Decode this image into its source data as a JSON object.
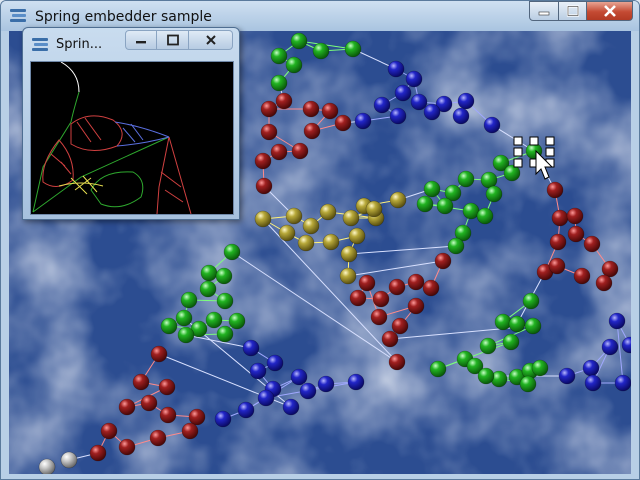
{
  "main_window": {
    "title": "Spring embedder sample",
    "icons": {
      "app": "app-icon",
      "minimize": "minimize-icon",
      "maximize": "maximize-icon",
      "close": "close-icon"
    }
  },
  "sub_window": {
    "title": "Sprin...",
    "icons": {
      "app": "app-icon",
      "minimize": "minimize-icon",
      "maximize": "maximize-icon",
      "close": "close-icon"
    }
  },
  "colors": {
    "background_blue": "#2c4d91",
    "node_red": "#8b1a1a",
    "node_green": "#22b422",
    "node_blue": "#2226c8",
    "node_yellow": "#b8a93a",
    "node_gray": "#c8c8c8",
    "close_red": "#c44a33"
  },
  "graph": {
    "nodes": [
      [
        "g",
        298,
        40
      ],
      [
        "g",
        320,
        50
      ],
      [
        "g",
        352,
        48
      ],
      [
        "g",
        278,
        55
      ],
      [
        "g",
        293,
        64
      ],
      [
        "g",
        278,
        82
      ],
      [
        "b",
        395,
        68
      ],
      [
        "b",
        413,
        78
      ],
      [
        "b",
        402,
        92
      ],
      [
        "b",
        381,
        104
      ],
      [
        "b",
        418,
        101
      ],
      [
        "b",
        443,
        103
      ],
      [
        "b",
        431,
        111
      ],
      [
        "b",
        465,
        100
      ],
      [
        "b",
        460,
        115
      ],
      [
        "b",
        397,
        115
      ],
      [
        "b",
        491,
        124
      ],
      [
        "r",
        268,
        108
      ],
      [
        "r",
        283,
        100
      ],
      [
        "r",
        268,
        131
      ],
      [
        "r",
        310,
        108
      ],
      [
        "r",
        329,
        110
      ],
      [
        "r",
        311,
        130
      ],
      [
        "r",
        342,
        122
      ],
      [
        "b",
        362,
        120
      ],
      [
        "r",
        299,
        150
      ],
      [
        "r",
        278,
        151
      ],
      [
        "r",
        262,
        160
      ],
      [
        "r",
        263,
        185
      ],
      [
        "g",
        500,
        162
      ],
      [
        "g",
        533,
        150
      ],
      [
        "r",
        554,
        189
      ],
      [
        "r",
        559,
        217
      ],
      [
        "r",
        574,
        215
      ],
      [
        "r",
        575,
        233
      ],
      [
        "r",
        591,
        243
      ],
      [
        "r",
        557,
        241
      ],
      [
        "r",
        544,
        271
      ],
      [
        "r",
        556,
        265
      ],
      [
        "r",
        581,
        275
      ],
      [
        "r",
        609,
        268
      ],
      [
        "r",
        603,
        282
      ],
      [
        "g",
        488,
        179
      ],
      [
        "g",
        465,
        178
      ],
      [
        "g",
        511,
        172
      ],
      [
        "g",
        452,
        192
      ],
      [
        "g",
        431,
        188
      ],
      [
        "g",
        444,
        205
      ],
      [
        "g",
        424,
        203
      ],
      [
        "g",
        470,
        210
      ],
      [
        "g",
        484,
        215
      ],
      [
        "g",
        493,
        193
      ],
      [
        "g",
        462,
        232
      ],
      [
        "g",
        455,
        245
      ],
      [
        "y",
        262,
        218
      ],
      [
        "y",
        293,
        215
      ],
      [
        "y",
        286,
        232
      ],
      [
        "y",
        310,
        225
      ],
      [
        "y",
        327,
        211
      ],
      [
        "y",
        350,
        217
      ],
      [
        "y",
        375,
        217
      ],
      [
        "y",
        397,
        199
      ],
      [
        "y",
        363,
        205
      ],
      [
        "y",
        373,
        208
      ],
      [
        "y",
        305,
        242
      ],
      [
        "y",
        330,
        241
      ],
      [
        "y",
        356,
        235
      ],
      [
        "y",
        348,
        253
      ],
      [
        "y",
        347,
        275
      ],
      [
        "r",
        442,
        260
      ],
      [
        "r",
        430,
        287
      ],
      [
        "r",
        415,
        281
      ],
      [
        "r",
        396,
        286
      ],
      [
        "r",
        380,
        298
      ],
      [
        "r",
        357,
        297
      ],
      [
        "r",
        366,
        282
      ],
      [
        "r",
        378,
        316
      ],
      [
        "r",
        415,
        305
      ],
      [
        "r",
        399,
        325
      ],
      [
        "r",
        389,
        338
      ],
      [
        "r",
        396,
        361
      ],
      [
        "g",
        231,
        251
      ],
      [
        "g",
        208,
        272
      ],
      [
        "g",
        223,
        275
      ],
      [
        "g",
        207,
        288
      ],
      [
        "g",
        224,
        300
      ],
      [
        "g",
        188,
        299
      ],
      [
        "g",
        183,
        317
      ],
      [
        "g",
        168,
        325
      ],
      [
        "g",
        198,
        328
      ],
      [
        "g",
        213,
        319
      ],
      [
        "g",
        236,
        320
      ],
      [
        "g",
        224,
        333
      ],
      [
        "g",
        185,
        334
      ],
      [
        "b",
        250,
        347
      ],
      [
        "b",
        274,
        362
      ],
      [
        "b",
        257,
        370
      ],
      [
        "b",
        272,
        388
      ],
      [
        "b",
        298,
        376
      ],
      [
        "b",
        307,
        390
      ],
      [
        "b",
        325,
        383
      ],
      [
        "b",
        355,
        381
      ],
      [
        "b",
        265,
        397
      ],
      [
        "b",
        245,
        409
      ],
      [
        "b",
        222,
        418
      ],
      [
        "b",
        290,
        406
      ],
      [
        "r",
        158,
        353
      ],
      [
        "r",
        140,
        381
      ],
      [
        "r",
        166,
        386
      ],
      [
        "r",
        126,
        406
      ],
      [
        "r",
        148,
        402
      ],
      [
        "r",
        167,
        414
      ],
      [
        "r",
        196,
        416
      ],
      [
        "r",
        189,
        430
      ],
      [
        "r",
        157,
        437
      ],
      [
        "r",
        126,
        446
      ],
      [
        "r",
        108,
        430
      ],
      [
        "r",
        97,
        452
      ],
      [
        "w",
        68,
        459
      ],
      [
        "w",
        46,
        466
      ],
      [
        "g",
        530,
        300
      ],
      [
        "g",
        502,
        321
      ],
      [
        "g",
        516,
        323
      ],
      [
        "g",
        532,
        325
      ],
      [
        "g",
        487,
        345
      ],
      [
        "g",
        510,
        341
      ],
      [
        "g",
        437,
        368
      ],
      [
        "g",
        464,
        358
      ],
      [
        "g",
        474,
        365
      ],
      [
        "g",
        498,
        378
      ],
      [
        "g",
        516,
        376
      ],
      [
        "g",
        529,
        370
      ],
      [
        "g",
        539,
        367
      ],
      [
        "g",
        527,
        383
      ],
      [
        "g",
        485,
        375
      ],
      [
        "b",
        566,
        375
      ],
      [
        "b",
        590,
        367
      ],
      [
        "b",
        609,
        346
      ],
      [
        "b",
        592,
        382
      ],
      [
        "b",
        622,
        382
      ],
      [
        "b",
        616,
        320
      ],
      [
        "b",
        629,
        344
      ]
    ],
    "edges": [
      [
        0,
        1
      ],
      [
        1,
        2
      ],
      [
        0,
        3
      ],
      [
        3,
        4
      ],
      [
        4,
        5
      ],
      [
        2,
        6
      ],
      [
        6,
        7
      ],
      [
        7,
        8
      ],
      [
        8,
        9
      ],
      [
        7,
        10
      ],
      [
        10,
        11
      ],
      [
        11,
        12
      ],
      [
        11,
        13
      ],
      [
        13,
        14
      ],
      [
        13,
        16
      ],
      [
        9,
        15
      ],
      [
        15,
        24
      ],
      [
        5,
        18
      ],
      [
        18,
        17
      ],
      [
        17,
        19
      ],
      [
        19,
        25
      ],
      [
        20,
        21
      ],
      [
        21,
        22
      ],
      [
        22,
        23
      ],
      [
        23,
        24
      ],
      [
        20,
        17
      ],
      [
        25,
        26
      ],
      [
        26,
        27
      ],
      [
        27,
        28
      ],
      [
        16,
        30
      ],
      [
        30,
        29
      ],
      [
        30,
        31
      ],
      [
        31,
        32
      ],
      [
        32,
        33
      ],
      [
        33,
        34
      ],
      [
        34,
        35
      ],
      [
        35,
        40
      ],
      [
        40,
        41
      ],
      [
        32,
        36
      ],
      [
        36,
        37
      ],
      [
        37,
        38
      ],
      [
        38,
        39
      ],
      [
        29,
        44
      ],
      [
        44,
        42
      ],
      [
        42,
        43
      ],
      [
        43,
        45
      ],
      [
        45,
        46
      ],
      [
        46,
        47
      ],
      [
        47,
        48
      ],
      [
        48,
        49
      ],
      [
        49,
        50
      ],
      [
        50,
        51
      ],
      [
        51,
        42
      ],
      [
        49,
        52
      ],
      [
        52,
        53
      ],
      [
        53,
        67
      ],
      [
        46,
        61
      ],
      [
        61,
        62
      ],
      [
        62,
        63
      ],
      [
        63,
        59
      ],
      [
        59,
        60
      ],
      [
        60,
        58
      ],
      [
        58,
        57
      ],
      [
        57,
        55
      ],
      [
        55,
        54
      ],
      [
        54,
        56
      ],
      [
        56,
        64
      ],
      [
        64,
        65
      ],
      [
        65,
        66
      ],
      [
        66,
        67
      ],
      [
        67,
        68
      ],
      [
        68,
        69
      ],
      [
        69,
        70
      ],
      [
        70,
        71
      ],
      [
        71,
        72
      ],
      [
        72,
        73
      ],
      [
        73,
        74
      ],
      [
        74,
        75
      ],
      [
        75,
        76
      ],
      [
        76,
        77
      ],
      [
        77,
        78
      ],
      [
        78,
        79
      ],
      [
        54,
        80
      ],
      [
        80,
        81
      ],
      [
        81,
        82
      ],
      [
        82,
        83
      ],
      [
        83,
        84
      ],
      [
        84,
        85
      ],
      [
        85,
        86
      ],
      [
        86,
        87
      ],
      [
        87,
        88
      ],
      [
        88,
        89
      ],
      [
        89,
        90
      ],
      [
        90,
        91
      ],
      [
        91,
        92
      ],
      [
        92,
        93
      ],
      [
        93,
        94
      ],
      [
        94,
        95
      ],
      [
        95,
        96
      ],
      [
        96,
        97
      ],
      [
        97,
        98
      ],
      [
        98,
        99
      ],
      [
        99,
        100
      ],
      [
        100,
        101
      ],
      [
        101,
        102
      ],
      [
        102,
        103
      ],
      [
        103,
        104
      ],
      [
        87,
        105
      ],
      [
        105,
        106
      ],
      [
        106,
        107
      ],
      [
        107,
        108
      ],
      [
        108,
        109
      ],
      [
        109,
        110
      ],
      [
        110,
        111
      ],
      [
        111,
        112
      ],
      [
        112,
        113
      ],
      [
        113,
        114
      ],
      [
        114,
        115
      ],
      [
        115,
        116
      ],
      [
        116,
        117
      ],
      [
        117,
        118
      ],
      [
        79,
        123
      ],
      [
        123,
        124
      ],
      [
        124,
        125
      ],
      [
        125,
        126
      ],
      [
        126,
        127
      ],
      [
        127,
        128
      ],
      [
        128,
        129
      ],
      [
        129,
        130
      ],
      [
        130,
        131
      ],
      [
        131,
        132
      ],
      [
        132,
        133
      ],
      [
        133,
        134
      ],
      [
        134,
        135
      ],
      [
        135,
        136
      ],
      [
        136,
        137
      ],
      [
        137,
        138
      ],
      [
        138,
        139
      ],
      [
        139,
        140
      ],
      [
        140,
        141
      ],
      [
        141,
        142
      ],
      [
        142,
        143
      ],
      [
        143,
        144
      ],
      [
        120,
        121
      ],
      [
        121,
        122
      ],
      [
        122,
        37
      ],
      [
        28,
        55
      ],
      [
        0,
        2
      ],
      [
        98,
        103
      ]
    ],
    "selected_node": 30
  }
}
